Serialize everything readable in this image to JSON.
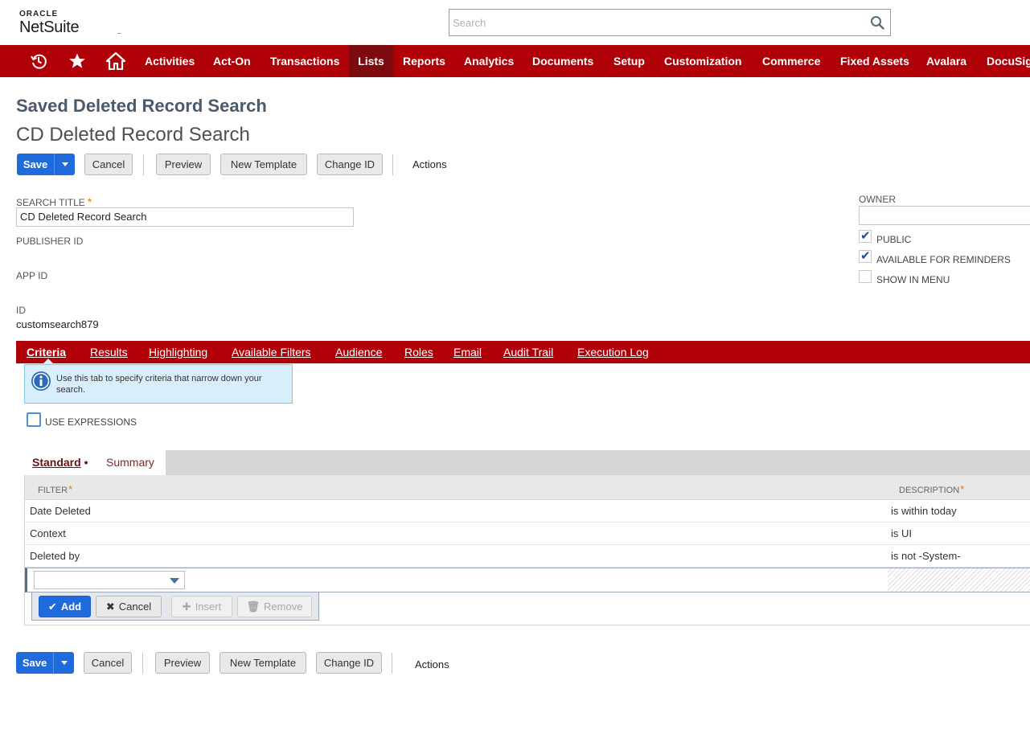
{
  "header": {
    "logo_top": "ORACLE",
    "logo_main": "NetSuite",
    "search_placeholder": "Search"
  },
  "nav": {
    "items": [
      "Activities",
      "Act-On",
      "Transactions",
      "Lists",
      "Reports",
      "Analytics",
      "Documents",
      "Setup",
      "Customization",
      "Commerce",
      "Fixed Assets",
      "Avalara",
      "DocuSign"
    ],
    "active": "Lists"
  },
  "page": {
    "type_title": "Saved Deleted Record Search",
    "title": "CD Deleted Record Search"
  },
  "toolbar": {
    "save": "Save",
    "cancel": "Cancel",
    "preview": "Preview",
    "new_template": "New Template",
    "change_id": "Change ID",
    "actions": "Actions"
  },
  "form": {
    "search_title_label": "SEARCH TITLE",
    "search_title_value": "CD Deleted Record Search",
    "publisher_id_label": "PUBLISHER ID",
    "app_id_label": "APP ID",
    "id_label": "ID",
    "id_value": "customsearch879",
    "owner_label": "OWNER",
    "owner_value": "",
    "public_label": "PUBLIC",
    "public_checked": true,
    "reminders_label": "AVAILABLE FOR REMINDERS",
    "reminders_checked": true,
    "show_menu_label": "SHOW IN MENU",
    "show_menu_checked": false
  },
  "subtabs": {
    "items": [
      "Criteria",
      "Results",
      "Highlighting",
      "Available Filters",
      "Audience",
      "Roles",
      "Email",
      "Audit Trail",
      "Execution Log"
    ],
    "active": "Criteria"
  },
  "criteria": {
    "info": "Use this tab to specify criteria that narrow down your search.",
    "use_expressions_label": "USE EXPRESSIONS",
    "inner_tabs": [
      "Standard",
      "Summary"
    ],
    "columns": {
      "filter": "FILTER",
      "description": "DESCRIPTION"
    },
    "rows": [
      {
        "filter": "Date Deleted",
        "description": "is within today"
      },
      {
        "filter": "Context",
        "description": "is UI"
      },
      {
        "filter": "Deleted by",
        "description": "is not -System-"
      }
    ],
    "row_buttons": {
      "add": "Add",
      "cancel": "Cancel",
      "insert": "Insert",
      "remove": "Remove"
    }
  },
  "colors": {
    "nav_bg": "#b00008",
    "nav_active": "#7d0a0f",
    "primary": "#1f6bde"
  }
}
